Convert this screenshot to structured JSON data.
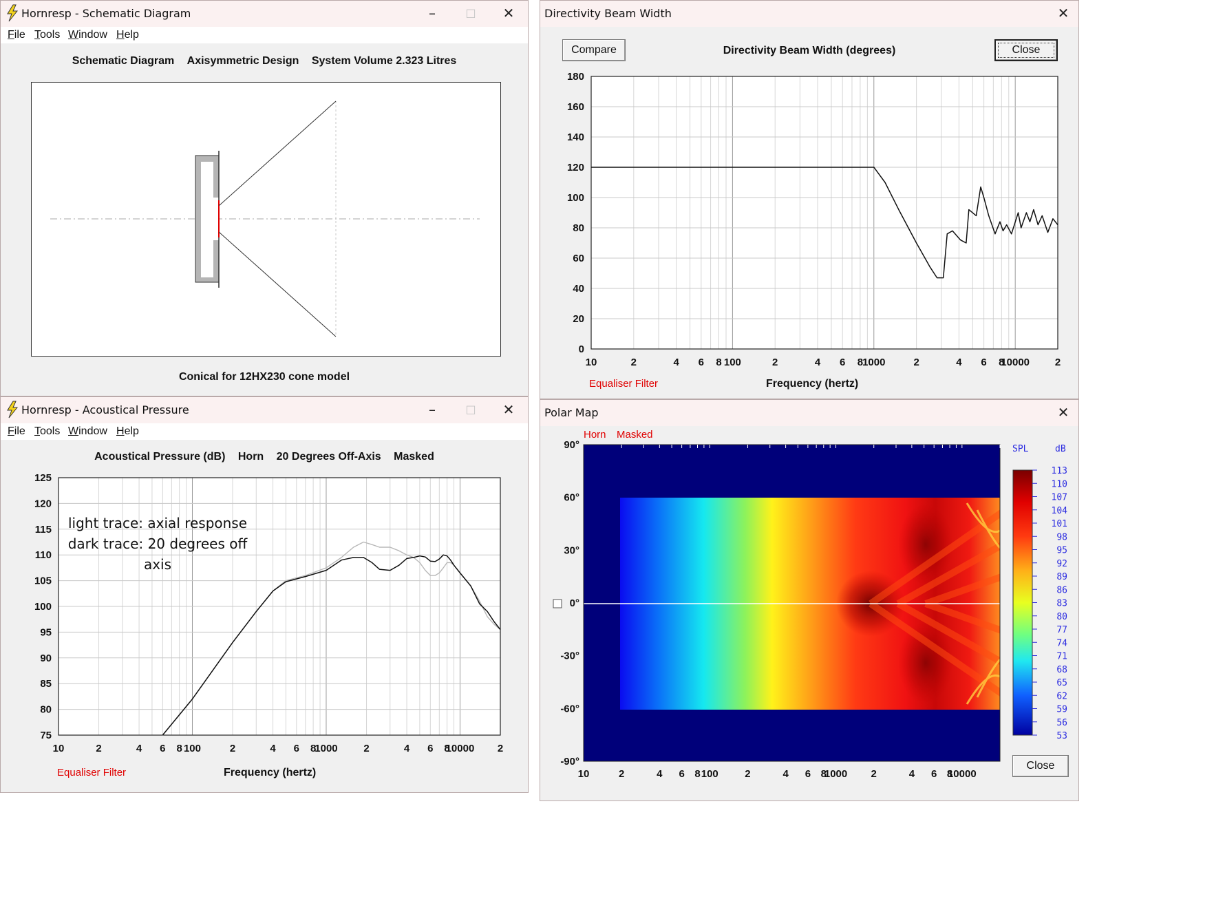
{
  "schematic": {
    "title": "Hornresp - Schematic Diagram",
    "menu": [
      "File",
      "Tools",
      "Window",
      "Help"
    ],
    "header": [
      "Schematic Diagram",
      "Axisymmetric Design",
      "System Volume 2.323 Litres"
    ],
    "footer": "Conical for 12HX230 cone model"
  },
  "beam": {
    "title": "Directivity Beam Width",
    "compare_label": "Compare",
    "chart_title": "Directivity Beam Width (degrees)",
    "close_label": "Close",
    "eq_label": "Equaliser Filter",
    "xlabel": "Frequency (hertz)"
  },
  "acoustic": {
    "title": "Hornresp - Acoustical Pressure",
    "menu": [
      "File",
      "Tools",
      "Window",
      "Help"
    ],
    "header": [
      "Acoustical Pressure (dB)",
      "Horn",
      "20 Degrees Off-Axis",
      "Masked"
    ],
    "annotation": [
      "light trace: axial response",
      "dark trace: 20 degrees off",
      "axis"
    ],
    "eq_label": "Equaliser Filter",
    "xlabel": "Frequency (hertz)"
  },
  "polar": {
    "title": "Polar Map",
    "tag_horn": "Horn",
    "tag_masked": "Masked",
    "spl_label": "SPL",
    "db_label": "dB",
    "close_label": "Close"
  },
  "chart_data": [
    {
      "id": "beam",
      "type": "line",
      "title": "Directivity Beam Width (degrees)",
      "xlabel": "Frequency (hertz)",
      "xscale": "log",
      "xlim": [
        10,
        20000
      ],
      "ylim": [
        0,
        180
      ],
      "yticks": [
        0,
        20,
        40,
        60,
        80,
        100,
        120,
        140,
        160,
        180
      ],
      "xtick_labels": [
        "10",
        "2",
        "4",
        "6",
        "8",
        "100",
        "2",
        "4",
        "6",
        "8",
        "1000",
        "2",
        "4",
        "6",
        "8",
        "10000",
        "2"
      ],
      "grid": true,
      "series": [
        {
          "x": [
            10,
            100,
            500,
            900,
            1000,
            1200,
            1500,
            2000,
            2500,
            2800,
            3100,
            3300,
            3600,
            4100,
            4500,
            4700,
            5300,
            5700,
            6000,
            6500,
            7200,
            7800,
            8200,
            8700,
            9400,
            10500,
            11000,
            12000,
            12700,
            13500,
            14500,
            15500,
            17000,
            18500,
            20000
          ],
          "y": [
            120,
            120,
            120,
            120,
            120,
            110,
            92,
            70,
            54,
            47,
            47,
            76,
            78,
            72,
            70,
            92,
            88,
            107,
            100,
            88,
            76,
            84,
            78,
            82,
            76,
            90,
            80,
            90,
            84,
            92,
            82,
            88,
            77,
            86,
            82
          ]
        }
      ]
    },
    {
      "id": "acoustic",
      "type": "line",
      "title": "Acoustical Pressure (dB)",
      "xlabel": "Frequency (hertz)",
      "xscale": "log",
      "xlim": [
        10,
        20000
      ],
      "ylim": [
        75,
        125
      ],
      "yticks": [
        75,
        80,
        85,
        90,
        95,
        100,
        105,
        110,
        115,
        120,
        125
      ],
      "xtick_labels": [
        "10",
        "2",
        "4",
        "6",
        "8",
        "100",
        "2",
        "4",
        "6",
        "8",
        "1000",
        "2",
        "4",
        "6",
        "8",
        "10000",
        "2"
      ],
      "grid": true,
      "series": [
        {
          "name": "light trace: axial response",
          "color": "#b8b8b8",
          "x": [
            60,
            100,
            200,
            300,
            400,
            500,
            700,
            1000,
            1300,
            1600,
            1900,
            2200,
            2500,
            3000,
            3500,
            4000,
            4500,
            5000,
            5500,
            6000,
            6500,
            7000,
            7500,
            8000,
            8500,
            9000,
            10000,
            12000,
            14000,
            16000,
            18000,
            20000
          ],
          "y": [
            75,
            82,
            93,
            99,
            103,
            105,
            106,
            107.5,
            109.5,
            111.5,
            112.5,
            112,
            111.5,
            111.5,
            110.8,
            110,
            109.5,
            108.5,
            107,
            106,
            106,
            106.5,
            107.5,
            108.5,
            108.5,
            108,
            106.5,
            104,
            101,
            98,
            96.5,
            95.5
          ]
        },
        {
          "name": "dark trace: 20 degrees off axis",
          "color": "#111111",
          "x": [
            60,
            100,
            200,
            300,
            400,
            500,
            700,
            1000,
            1300,
            1600,
            1900,
            2200,
            2500,
            3000,
            3500,
            4000,
            4500,
            5000,
            5500,
            6000,
            6500,
            7000,
            7500,
            8000,
            8500,
            9000,
            10000,
            12000,
            14000,
            16000,
            18000,
            20000
          ],
          "y": [
            75,
            82,
            93,
            99,
            103,
            104.8,
            105.8,
            107,
            109,
            109.5,
            109.5,
            108.5,
            107.2,
            107,
            108,
            109.3,
            109.5,
            109.8,
            109.6,
            108.8,
            108.7,
            109.2,
            110,
            109.8,
            109,
            108,
            106.5,
            104,
            100.5,
            99,
            97,
            95.5
          ]
        }
      ]
    },
    {
      "id": "polar",
      "type": "heatmap",
      "title": "Polar Map",
      "xscale": "log",
      "xlim": [
        10,
        20000
      ],
      "ylim": [
        -90,
        90
      ],
      "ytick_labels": [
        "90°",
        "60°",
        "30°",
        "0°",
        "-30°",
        "-60°",
        "-90°"
      ],
      "yticks": [
        90,
        60,
        30,
        0,
        -30,
        -60,
        -90
      ],
      "xtick_labels": [
        "10",
        "2",
        "4",
        "6",
        "8",
        "100",
        "2",
        "4",
        "6",
        "8",
        "1000",
        "2",
        "4",
        "6",
        "8",
        "10000"
      ],
      "colorbar_ticks": [
        113,
        110,
        107,
        104,
        101,
        98,
        95,
        92,
        89,
        86,
        83,
        80,
        77,
        74,
        71,
        68,
        65,
        62,
        59,
        56,
        53
      ],
      "colorbar_range": [
        53,
        113
      ]
    }
  ]
}
